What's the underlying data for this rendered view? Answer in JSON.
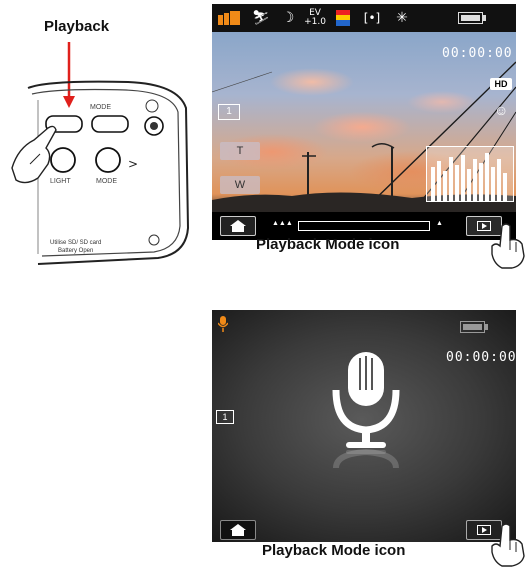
{
  "labels": {
    "playback": "Playback",
    "mode_icon_1": "Playback Mode icon",
    "mode_icon_2": "Playback Mode icon"
  },
  "camera": {
    "mode_button": "MODE",
    "light_button": "LIGHT",
    "mode_button_2": "MODE",
    "fine_print_1": "Utilise SD/ SD card",
    "fine_print_2": "Battery Open"
  },
  "screen1": {
    "ev_label": "EV",
    "ev_value": "+1.0",
    "time": "00:00:00",
    "t_button": "T",
    "w_button": "W",
    "frame_badge": "1",
    "zoom_left": "▲▲▲",
    "zoom_right": "▲"
  },
  "screen2": {
    "time": "00:00:00",
    "frame_badge": "1"
  },
  "colors": {
    "arrow": "#e0201c",
    "mode_icon_orange": "#f08a18"
  },
  "icons": [
    "camera-mode-icon",
    "scene-icon",
    "night-icon",
    "ev-icon",
    "color-icon",
    "metering-icon",
    "flash-icon",
    "battery-icon",
    "hd-icon",
    "face-detect-icon",
    "histogram-icon",
    "home-icon",
    "play-icon",
    "microphone-icon",
    "hand-pointer-icon"
  ]
}
